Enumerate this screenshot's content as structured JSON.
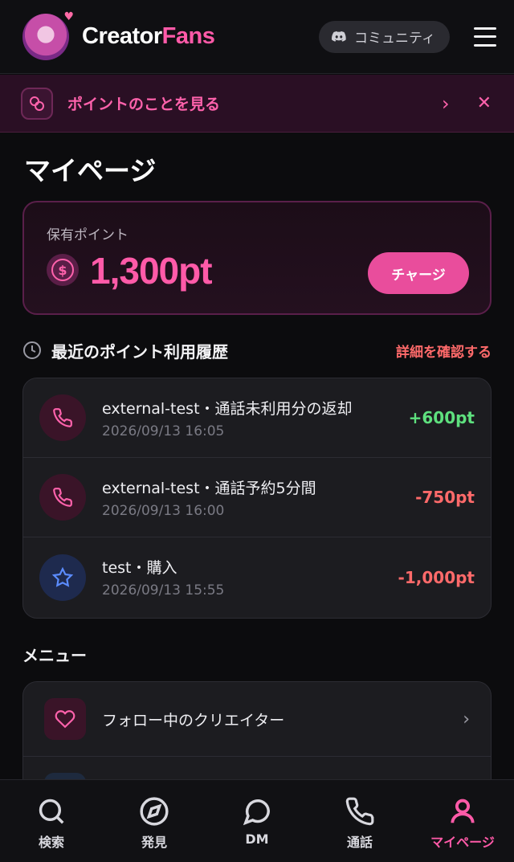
{
  "header": {
    "brand_part1": "Creator",
    "brand_part2": "Fans",
    "community_label": "コミュニティ"
  },
  "banner": {
    "text": "ポイントのことを見る"
  },
  "page_title": "マイページ",
  "points": {
    "label": "保有ポイント",
    "value": "1,300pt",
    "charge_label": "チャージ"
  },
  "history": {
    "title": "最近のポイント利用履歴",
    "link": "詳細を確認する",
    "items": [
      {
        "title": "external-test・通話未利用分の返却",
        "date": "2026/09/13 16:05",
        "amount": "+600pt",
        "type": "plus",
        "icon": "phone-icon"
      },
      {
        "title": "external-test・通話予約5分間",
        "date": "2026/09/13 16:00",
        "amount": "-750pt",
        "type": "minus",
        "icon": "phone-icon"
      },
      {
        "title": "test・購入",
        "date": "2026/09/13 15:55",
        "amount": "-1,000pt",
        "type": "minus",
        "icon": "star-icon"
      }
    ]
  },
  "menu": {
    "title": "メニュー",
    "items": [
      {
        "label": "フォロー中のクリエイター",
        "icon": "heart-icon"
      }
    ]
  },
  "nav": {
    "items": [
      {
        "label": "検索",
        "icon": "search-icon"
      },
      {
        "label": "発見",
        "icon": "compass-icon"
      },
      {
        "label": "DM",
        "icon": "chat-bubble-icon"
      },
      {
        "label": "通話",
        "icon": "phone-icon"
      },
      {
        "label": "マイページ",
        "icon": "user-icon",
        "active": true
      }
    ]
  },
  "colors": {
    "accent": "#ff5aa8",
    "plus": "#5ee07e",
    "minus": "#ff6a6a",
    "background": "#0c0c0e"
  }
}
